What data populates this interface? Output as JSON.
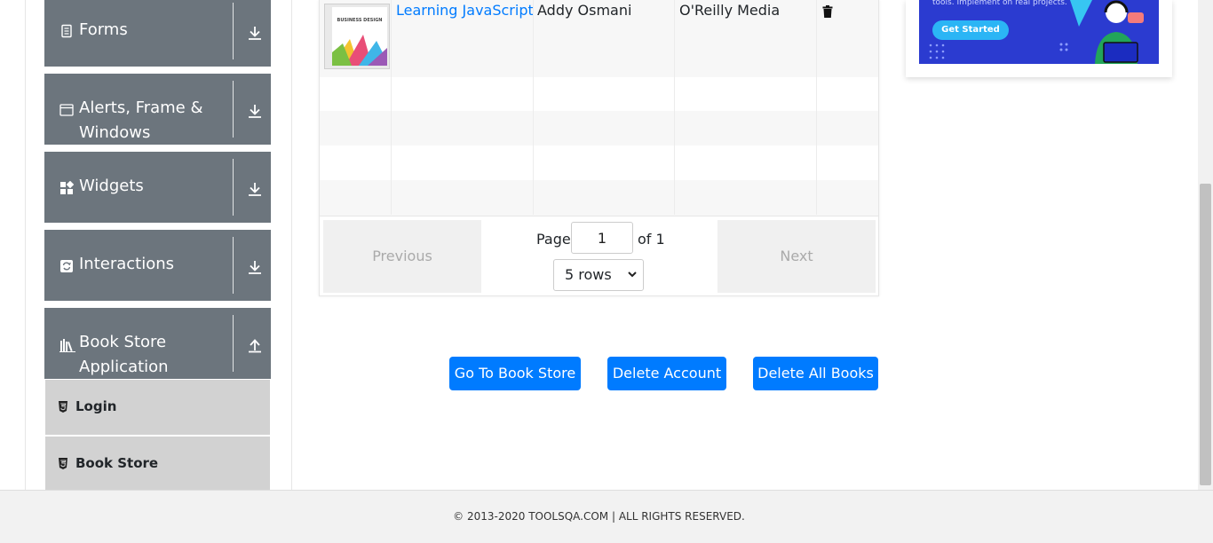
{
  "sidebar": {
    "groups": [
      {
        "label": "Forms",
        "icon": "document-icon",
        "arrow": "download-arrow-icon"
      },
      {
        "label": "Alerts, Frame & Windows",
        "icon": "window-icon",
        "arrow": "download-arrow-icon"
      },
      {
        "label": "Widgets",
        "icon": "widgets-icon",
        "arrow": "download-arrow-icon"
      },
      {
        "label": "Interactions",
        "icon": "interactions-icon",
        "arrow": "download-arrow-icon"
      },
      {
        "label": "Book Store Application",
        "icon": "books-icon",
        "arrow": "upload-arrow-icon"
      }
    ],
    "sub_items": [
      {
        "label": "Login",
        "icon": "html5-icon"
      },
      {
        "label": "Book Store",
        "icon": "html5-icon"
      }
    ]
  },
  "books_table": {
    "rows": [
      {
        "title": "Learning JavaScript Design Patterns",
        "author": "Addy Osmani",
        "publisher": "O'Reilly Media",
        "cover_text": "BUSINESS DESIGN",
        "action_icon": "trash-icon"
      }
    ]
  },
  "pagination": {
    "previous_label": "Previous",
    "next_label": "Next",
    "page_label": "Page",
    "page_value": "1",
    "of_label": "of 1",
    "rows_option": "5 rows"
  },
  "actions": {
    "go_to_store": "Go To Book Store",
    "delete_account": "Delete Account",
    "delete_all_books": "Delete All Books"
  },
  "ad": {
    "text": "tools. Implement on real projects.",
    "button": "Get Started"
  },
  "footer": {
    "text": "© 2013-2020 TOOLSQA.COM | ALL RIGHTS RESERVED."
  },
  "colors": {
    "primary": "#007bff",
    "sidebar_group": "#6c757d",
    "sub_item": "#d2d2d2",
    "ad_bg": "#2b3bd0"
  }
}
